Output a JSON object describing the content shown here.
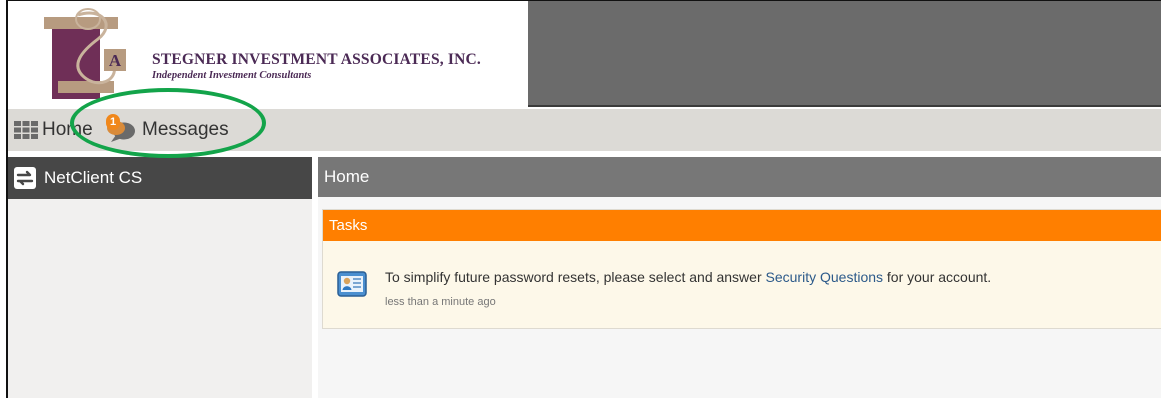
{
  "header": {
    "company_name": "STEGNER INVESTMENT ASSOCIATES, INC.",
    "tagline": "Independent Investment Consultants",
    "logo_letter": "A"
  },
  "topnav": {
    "home_label": "Home",
    "messages_label": "Messages",
    "messages_badge": "1"
  },
  "sidebar": {
    "title": "NetClient CS"
  },
  "main": {
    "title": "Home",
    "tasks": {
      "title": "Tasks",
      "items": [
        {
          "text_before": "To simplify future password resets, please select and answer ",
          "link_text": "Security Questions",
          "text_after": " for your account.",
          "time": "less than a minute ago"
        }
      ]
    }
  },
  "colors": {
    "accent_orange": "#ff7f00",
    "brand_purple": "#4b2a55",
    "highlight_green": "#13a44a",
    "link_blue": "#2c5a8a"
  },
  "icons": {
    "home": "grid-icon",
    "messages": "speech-bubble-icon",
    "sidebar": "swap-arrows-icon",
    "task": "id-card-icon"
  }
}
